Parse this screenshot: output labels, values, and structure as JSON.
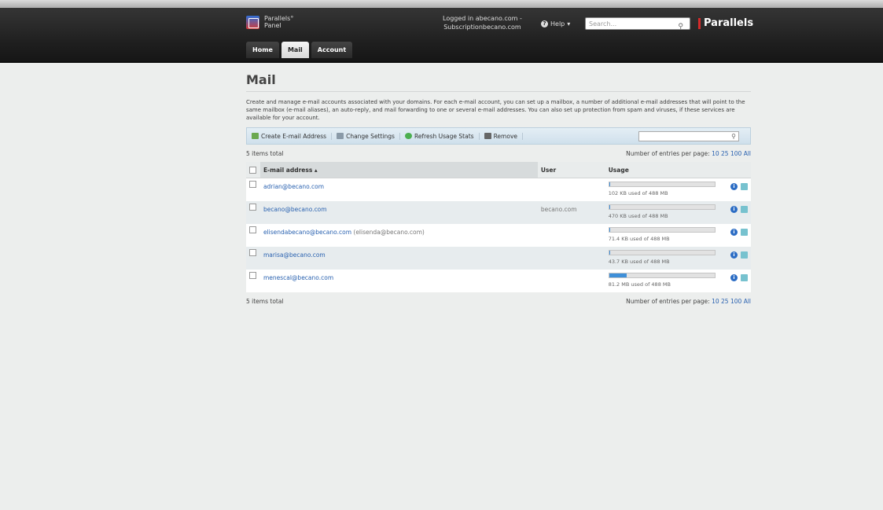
{
  "header": {
    "logo_line1": "Parallels°",
    "logo_line2": "Panel",
    "login_line1": "Logged in abecano.com -",
    "login_line2": "Subscriptionbecano.com",
    "help_label": "Help",
    "search_placeholder": "Search...",
    "brand": "Parallels",
    "tabs": [
      {
        "label": "Home"
      },
      {
        "label": "Mail"
      },
      {
        "label": "Account"
      }
    ]
  },
  "page": {
    "title": "Mail",
    "intro": "Create and manage e-mail accounts associated with your domains. For each e-mail account, you can set up a mailbox, a number of additional e-mail addresses that will point to the same mailbox (e-mail aliases), an auto-reply, and mail forwarding to one or several e-mail addresses. You can also set up protection from spam and viruses, if these services are available for your account."
  },
  "toolbar": {
    "create": "Create E-mail Address",
    "change": "Change Settings",
    "refresh": "Refresh Usage Stats",
    "remove": "Remove"
  },
  "listing": {
    "total": "5 items total",
    "per_page_label": "Number of entries per page:",
    "per_page_options": [
      "10",
      "25",
      "100",
      "All"
    ],
    "columns": {
      "email": "E-mail address ▴",
      "user": "User",
      "usage": "Usage"
    },
    "rows": [
      {
        "email": "adrian@becano.com",
        "alias": "",
        "user": "",
        "usage": "102 KB used of 488 MB",
        "fill": 0.002
      },
      {
        "email": "becano@becano.com",
        "alias": "",
        "user": "becano.com",
        "usage": "470 KB used of 488 MB",
        "fill": 0.01
      },
      {
        "email": "elisendabecano@becano.com",
        "alias": "(elisenda@becano.com)",
        "user": "",
        "usage": "71.4 KB used of 488 MB",
        "fill": 0.002
      },
      {
        "email": "marisa@becano.com",
        "alias": "",
        "user": "",
        "usage": "43.7 KB used of 488 MB",
        "fill": 0.001
      },
      {
        "email": "menescal@becano.com",
        "alias": "",
        "user": "",
        "usage": "81.2 MB used of 488 MB",
        "fill": 0.166
      }
    ]
  },
  "colors": {
    "link": "#2a62b0",
    "usage_fill": "#3f8fd8",
    "brand_accent": "#d42a2a"
  }
}
